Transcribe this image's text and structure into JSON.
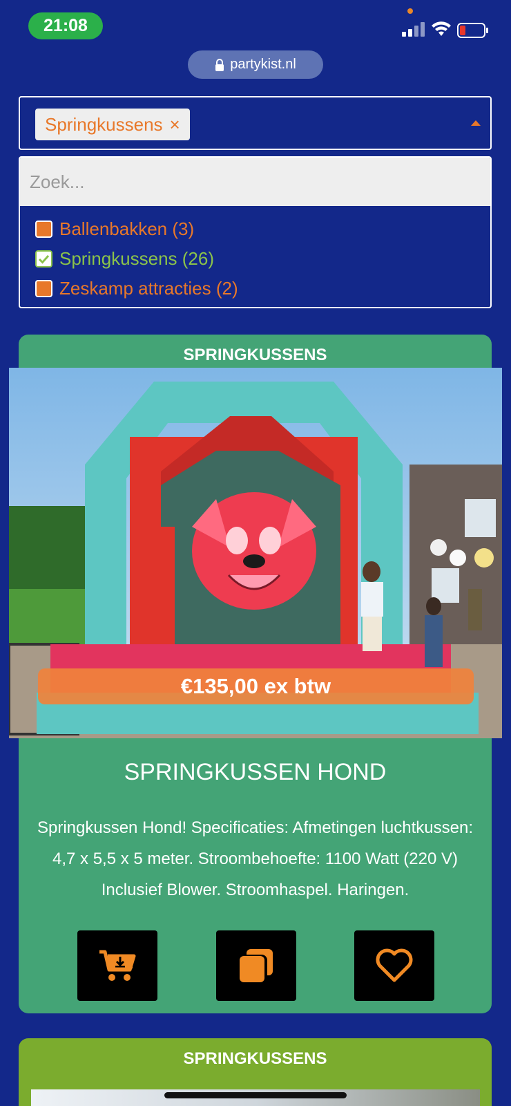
{
  "status_bar": {
    "time": "21:08"
  },
  "browser": {
    "url": "partykist.nl"
  },
  "filter": {
    "selected_chip": "Springkussens",
    "chip_remove": "×",
    "search_placeholder": "Zoek...",
    "options": [
      {
        "label": "Ballenbakken (3)",
        "checked": false
      },
      {
        "label": "Springkussens (26)",
        "checked": true
      },
      {
        "label": "Zeskamp attracties (2)",
        "checked": false
      }
    ]
  },
  "product": {
    "category": "SPRINGKUSSENS",
    "price": "€135,00 ex btw",
    "title": "SPRINGKUSSEN HOND",
    "description": "Springkussen Hond! Specificaties: Afmetingen luchtkussen: 4,7 x 5,5 x 5 meter. Stroombehoefte: 1100 Watt (220 V) Inclusief Blower. Stroomhaspel. Haringen.",
    "actions": [
      "cart-add-icon",
      "copy-icon",
      "heart-icon"
    ]
  },
  "next_product": {
    "category": "SPRINGKUSSENS"
  },
  "colors": {
    "background": "#13288a",
    "accent": "#e8782a",
    "card_green": "#44a476",
    "card2_green": "#7bac2e",
    "checked_green": "#8bc34a"
  }
}
